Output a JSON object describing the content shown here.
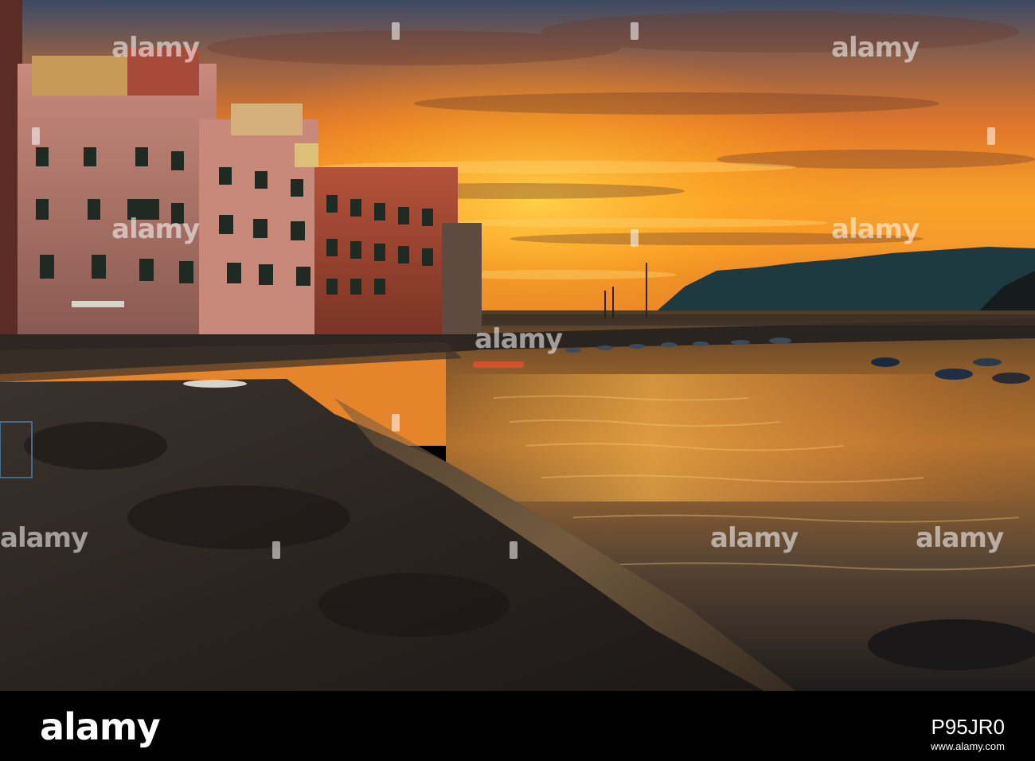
{
  "image": {
    "scene": "sunset harbor",
    "colors": {
      "sky_top": "#3b4a63",
      "sun": "#ffb419",
      "sea_glow": "#e28a2a",
      "sand": "#2d2822",
      "buildings": "#c87c6f"
    }
  },
  "watermark": {
    "text": "alamy"
  },
  "footer": {
    "brand": "alamy",
    "image_id": "P95JR0",
    "info": "www.alamy.com"
  }
}
